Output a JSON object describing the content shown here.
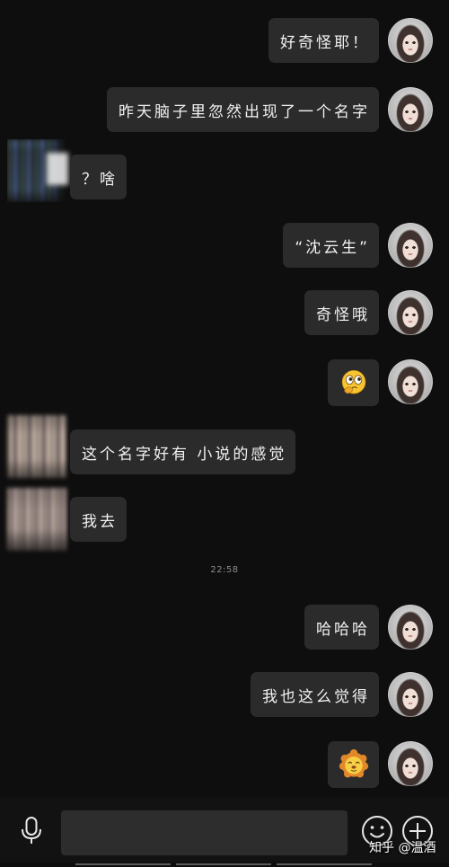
{
  "chat": {
    "messages": [
      {
        "side": "right",
        "type": "text",
        "text": "好奇怪耶！"
      },
      {
        "side": "right",
        "type": "text",
        "text": "昨天脑子里忽然出现了一个名字"
      },
      {
        "side": "left",
        "type": "text",
        "text": "？啥"
      },
      {
        "side": "right",
        "type": "text",
        "text": "“沈云生”"
      },
      {
        "side": "right",
        "type": "text",
        "text": "奇怪哦"
      },
      {
        "side": "right",
        "type": "emoji",
        "emoji": "thinking-face-icon"
      },
      {
        "side": "left",
        "type": "text",
        "text": "这个名字好有 小说的感觉"
      },
      {
        "side": "left",
        "type": "text",
        "text": "我去"
      },
      {
        "side": "right",
        "type": "text",
        "text": "哈哈哈"
      },
      {
        "side": "right",
        "type": "text",
        "text": "我也这么觉得"
      },
      {
        "side": "right",
        "type": "emoji",
        "emoji": "lion-face-icon"
      }
    ],
    "timestamp": "22:58"
  },
  "input_bar": {
    "value": "",
    "icons": [
      "microphone-icon",
      "smiley-icon",
      "plus-icon"
    ]
  },
  "watermark": "知乎 @温酒",
  "colors": {
    "background": "#0e0e0e",
    "bubble": "#2b2b2b",
    "text": "#f0f0f0",
    "input_field": "#2d2d2d"
  }
}
